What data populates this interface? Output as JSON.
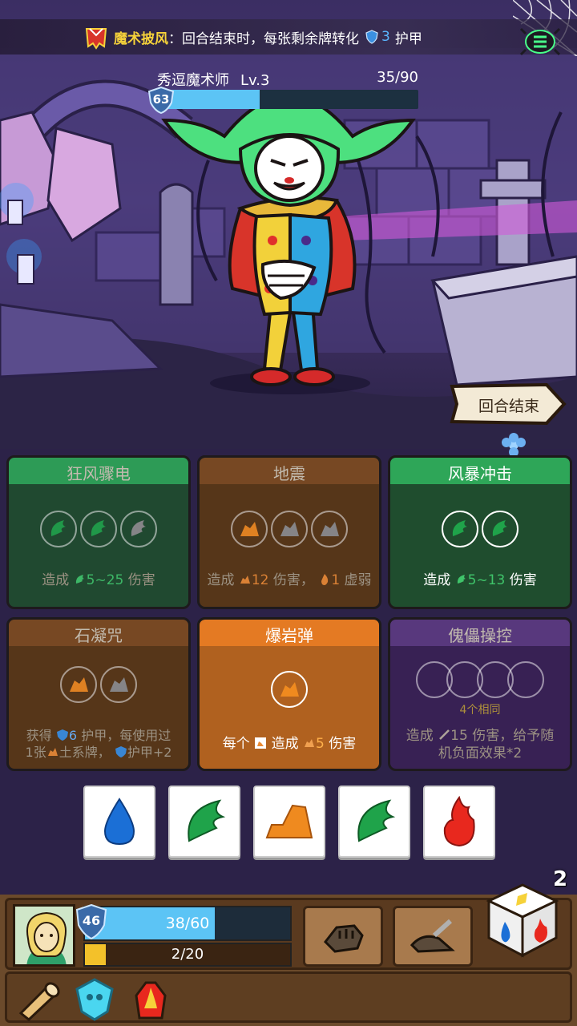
{
  "relic": {
    "name": "魔术披风",
    "colon": "：",
    "desc": "回合结束时，每张剩余牌转化",
    "armor_value": "3",
    "armor_label": "护甲"
  },
  "enemy": {
    "name": "秀逗魔术师",
    "level": "Lv.3",
    "hp_text": "35/90",
    "hp_ratio": 0.39,
    "shield": "63"
  },
  "end_turn_label": "回合结束",
  "cards": [
    {
      "title": "狂风骤电",
      "style": "green dim",
      "desc": [
        "造成",
        "5~25",
        "伤害"
      ]
    },
    {
      "title": "地震",
      "style": "brown dim",
      "desc": [
        "造成",
        "12",
        "伤害，",
        "1",
        "虚弱"
      ]
    },
    {
      "title": "风暴冲击",
      "style": "green",
      "desc": [
        "造成",
        "5~13",
        "伤害"
      ]
    },
    {
      "title": "石凝咒",
      "style": "brown dim",
      "desc": [
        "获得",
        "6",
        "护甲，每使用过",
        "1张",
        "土系牌，",
        "护甲+2"
      ]
    },
    {
      "title": "爆岩弹",
      "style": "orange",
      "desc": [
        "每个",
        "造成",
        "5",
        "伤害"
      ]
    },
    {
      "title": "傀儡操控",
      "style": "purple dim",
      "note": "4个相同",
      "desc": [
        "造成",
        "15",
        "伤害，给予随",
        "机负面效果*2"
      ]
    }
  ],
  "dice_hand": [
    "water",
    "wind",
    "earth",
    "wind",
    "fire"
  ],
  "player": {
    "shield": "46",
    "hp_text": "38/60",
    "hp_ratio": 0.633,
    "xp_text": "2/20",
    "xp_ratio": 0.1,
    "dice_remaining": "2"
  },
  "colors": {
    "wind": "#1fa34a",
    "water": "#1b6fd6",
    "earth": "#ef8a1f",
    "fire": "#e8281e",
    "accent_gold": "#f6d23a",
    "armor_blue": "#5ab6ff"
  }
}
